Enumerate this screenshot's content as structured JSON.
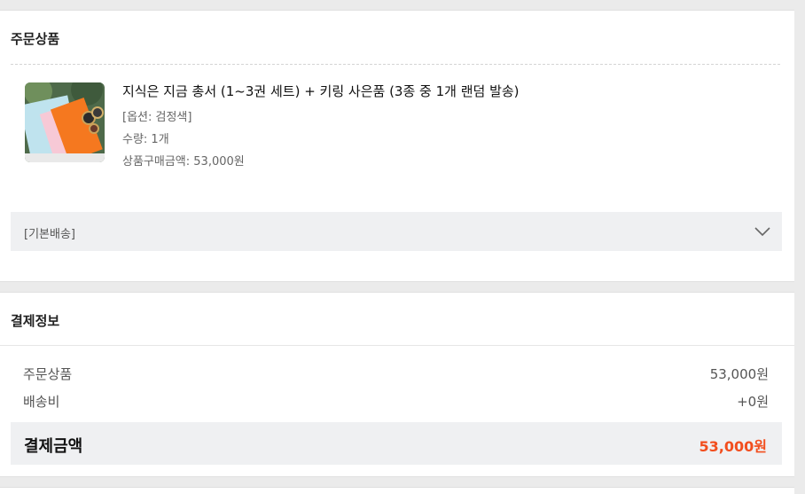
{
  "order": {
    "title": "주문상품",
    "product": {
      "name": "지식은 지금 총서 (1~3권 세트) + 키링 사은품 (3종 중 1개 랜덤 발송)",
      "option": "[옵션: 검정색]",
      "quantity": "수량: 1개",
      "price": "상품구매금액: 53,000원"
    },
    "shipping": {
      "label": "[기본배송]",
      "icon": "chevron-down-icon"
    }
  },
  "payment": {
    "title": "결제정보",
    "rows": [
      {
        "label": "주문상품",
        "value": "53,000원"
      },
      {
        "label": "배송비",
        "value": "+0원"
      }
    ],
    "total": {
      "label": "결제금액",
      "value": "53,000원"
    }
  },
  "colors": {
    "accent": "#f24e1e",
    "panel_bg": "#eff0f2",
    "page_bg": "#ebebeb"
  }
}
